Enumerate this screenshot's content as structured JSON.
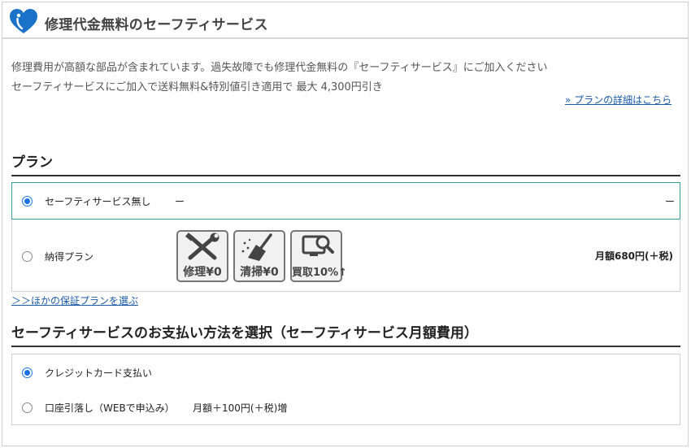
{
  "header": {
    "title": "修理代金無料のセーフティサービス",
    "icon": "heart-icon",
    "accent_color": "#1a73c8"
  },
  "intro": {
    "line1": "修理費用が高額な部品が含まれています。過失故障でも修理代金無料の『セーフティサービス』にご加入ください",
    "line2": "セーフティサービスにご加入で送料無料&特別値引き適用で 最大 4,300円引き",
    "plan_detail_link": "» プランの詳細はこちら"
  },
  "plan": {
    "heading": "プラン",
    "options": [
      {
        "label": "セーフティサービス無し",
        "dash": "ー",
        "price": "ー",
        "selected": true
      },
      {
        "label": "納得プラン",
        "price": "月額680円(＋税)",
        "selected": false,
        "features": [
          {
            "icon": "tools-icon",
            "text": "修理¥0"
          },
          {
            "icon": "broom-icon",
            "text": "清掃¥0"
          },
          {
            "icon": "magnifier-icon",
            "text": "買取10%↑"
          }
        ]
      }
    ],
    "other_plans_link": "＞＞ほかの保証プランを選ぶ"
  },
  "payment": {
    "heading": "セーフティサービスのお支払い方法を選択（セーフティサービス月額費用）",
    "options": [
      {
        "label": "クレジットカード支払い",
        "selected": true
      },
      {
        "label": "口座引落し（WEBで申込み）",
        "extra": "月額＋100円(＋税)増",
        "selected": false
      }
    ]
  }
}
